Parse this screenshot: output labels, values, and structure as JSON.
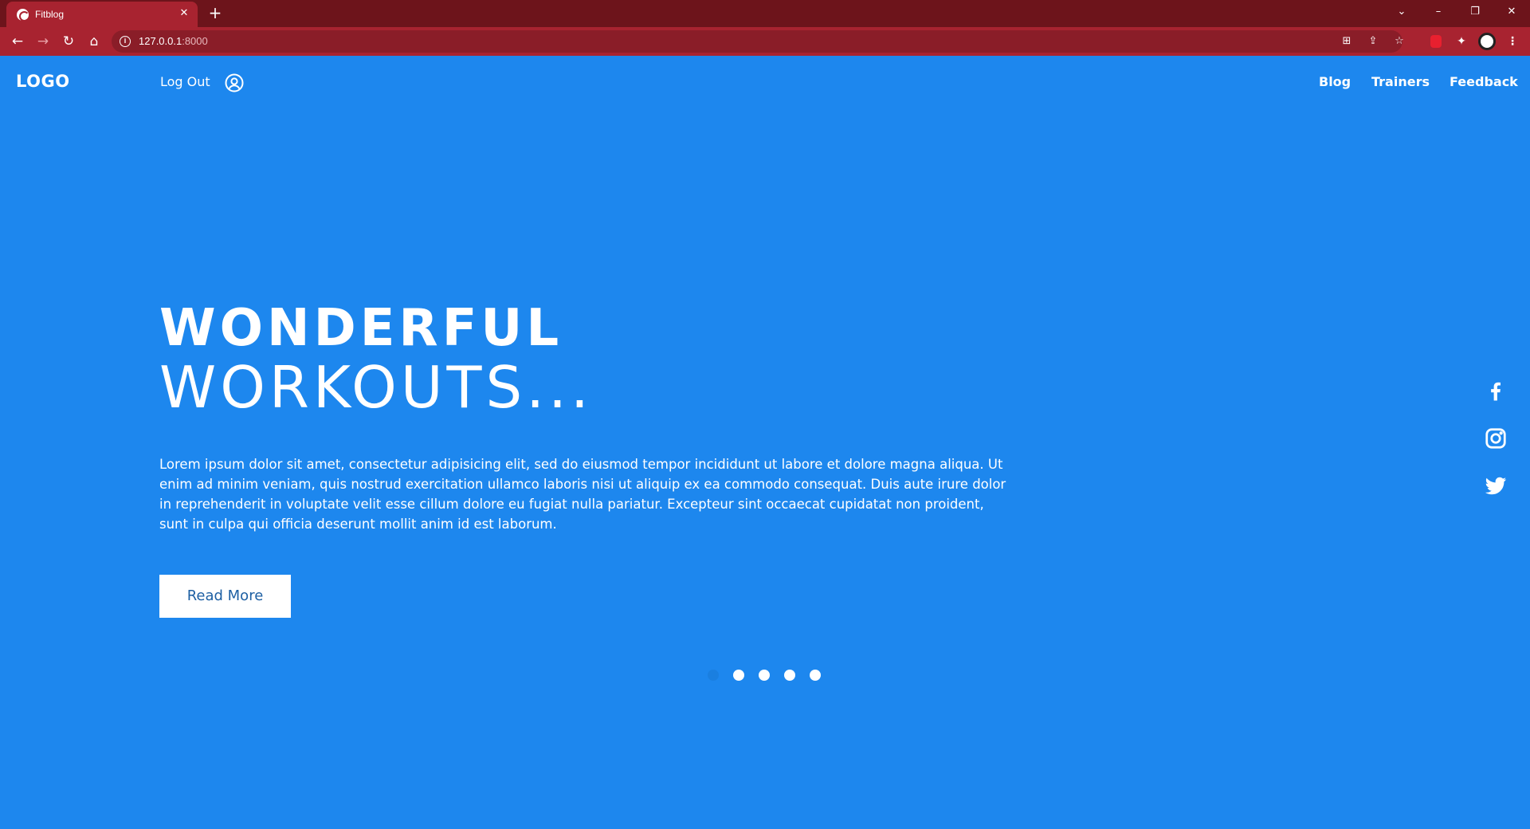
{
  "browser": {
    "tab_title": "Fitblog",
    "tab_close": "✕",
    "new_tab": "+",
    "url_host": "127.0.0.1",
    "url_port": ":8000",
    "win_dropdown": "⌄",
    "win_minimize": "–",
    "win_maximize": "❐",
    "win_close": "✕",
    "nav_back": "←",
    "nav_forward": "→",
    "nav_reload": "↻",
    "nav_home": "⌂",
    "info": "i",
    "translate": "⊞",
    "share": "⇪",
    "star": "☆",
    "puzzle": "✦",
    "menu": "⋮"
  },
  "header": {
    "logo": "LOGO",
    "logout": "Log Out",
    "nav": [
      {
        "label": "Blog"
      },
      {
        "label": "Trainers"
      },
      {
        "label": "Feedback"
      }
    ]
  },
  "hero": {
    "title_line1": "WONDERFUL",
    "title_line2": "WORKOUTS...",
    "body": "Lorem ipsum dolor sit amet, consectetur adipisicing elit, sed do eiusmod tempor incididunt ut labore et dolore magna aliqua. Ut enim ad minim veniam, quis nostrud exercitation ullamco laboris nisi ut aliquip ex ea commodo consequat. Duis aute irure dolor in reprehenderit in voluptate velit esse cillum dolore eu fugiat nulla pariatur. Excepteur sint occaecat cupidatat non proident, sunt in culpa qui officia deserunt mollit anim id est laborum.",
    "button": "Read More"
  },
  "carousel": {
    "slides": 5,
    "active_index": 0
  },
  "social": [
    "facebook-icon",
    "instagram-icon",
    "twitter-icon"
  ],
  "colors": {
    "page_bg": "#1d87ee",
    "chrome_tabbar": "#6d141b",
    "chrome_toolbar": "#a82330",
    "button_text": "#1d5fa3"
  }
}
